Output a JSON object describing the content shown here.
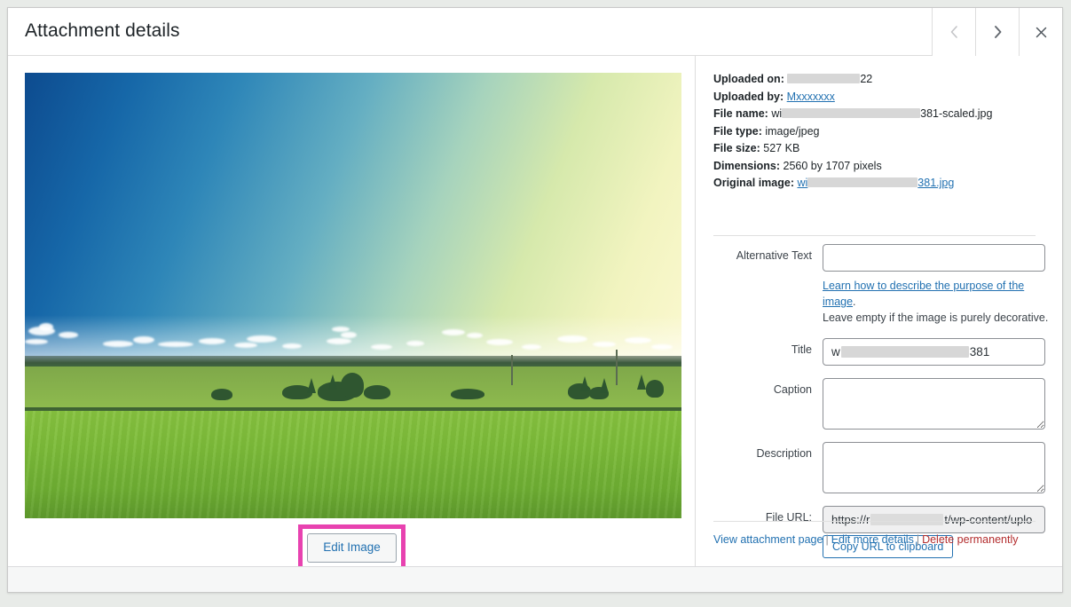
{
  "modal": {
    "title": "Attachment details",
    "nav": {
      "prev_label": "Previous",
      "next_label": "Next",
      "close_label": "Close"
    }
  },
  "preview": {
    "edit_image_label": "Edit Image",
    "highlight_color": "#e842b0",
    "image_description": "Green meadow field under a blue-to-yellow gradient sky with distant treeline"
  },
  "meta": {
    "uploaded_on": {
      "label": "Uploaded on:",
      "value_suffix": "22"
    },
    "uploaded_by": {
      "label": "Uploaded by:",
      "value": "Mxxxxxxx"
    },
    "file_name": {
      "label": "File name:",
      "prefix": "wi",
      "suffix": "381-scaled.jpg"
    },
    "file_type": {
      "label": "File type:",
      "value": "image/jpeg"
    },
    "file_size": {
      "label": "File size:",
      "value": "527 KB"
    },
    "dimensions": {
      "label": "Dimensions:",
      "value": "2560 by 1707 pixels"
    },
    "original_image": {
      "label": "Original image:",
      "prefix": "wi",
      "suffix": "381.jpg"
    }
  },
  "form": {
    "alt_text": {
      "label": "Alternative Text",
      "value": "",
      "help_link": "Learn how to describe the purpose of the image",
      "help_link_suffix": ".",
      "help_text": "Leave empty if the image is purely decorative."
    },
    "title": {
      "label": "Title",
      "prefix": "w",
      "suffix": "381"
    },
    "caption": {
      "label": "Caption",
      "value": ""
    },
    "description": {
      "label": "Description",
      "value": ""
    },
    "file_url": {
      "label": "File URL:",
      "prefix": "https://r",
      "suffix": "t/wp-content/uplo",
      "copy_button": "Copy URL to clipboard"
    }
  },
  "actions": {
    "view": "View attachment page",
    "edit_more": "Edit more details",
    "delete": "Delete permanently",
    "separator": "|"
  },
  "colors": {
    "link": "#2271b1",
    "danger": "#b32d2e",
    "highlight": "#e842b0"
  }
}
